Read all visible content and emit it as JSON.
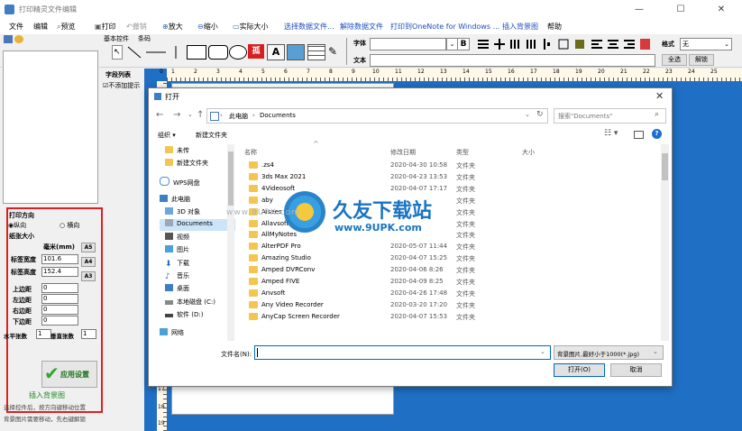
{
  "app": {
    "title": "打印精灵文件编辑",
    "win_controls": {
      "minimize": "—",
      "maximize": "☐",
      "close": "✕"
    }
  },
  "menu": [
    {
      "label": "文件"
    },
    {
      "label": "编辑"
    },
    {
      "label": "预览"
    },
    {
      "label": "打印"
    },
    {
      "label": "撤销"
    },
    {
      "label": "放大"
    },
    {
      "label": "缩小"
    },
    {
      "label": "实际大小"
    },
    {
      "label": "选择数据文件..."
    },
    {
      "label": "解除数据文件"
    },
    {
      "label": "打印到OneNote for Windows ..."
    },
    {
      "label": "插入背景图"
    },
    {
      "label": "帮助"
    }
  ],
  "toolbar": {
    "tabs": [
      "基本控件",
      "条码"
    ],
    "font_label": "字体",
    "text_label": "文本",
    "bold": "B",
    "style_label": "格式",
    "style_value": "无",
    "select_all": "全选",
    "unlock": "解锁",
    "arc_char": "孤",
    "a_char": "A"
  },
  "left_panel": {
    "field_list_label": "字段列表",
    "no_add_checkbox": "不添加提示",
    "print_direction_label": "打印方向",
    "portrait": "纵向",
    "landscape": "横向",
    "paper_size_label": "纸张大小",
    "unit_label": "毫米(mm)",
    "size_buttons": [
      "A5",
      "A4",
      "A3"
    ],
    "label_width_label": "标签宽度",
    "label_width": "101.6",
    "label_height_label": "标签高度",
    "label_height": "152.4",
    "margin_top_label": "上边距",
    "margin_top": "0",
    "margin_left_label": "左边距",
    "margin_left": "0",
    "margin_right_label": "右边距",
    "margin_right": "0",
    "margin_bottom_label": "下边距",
    "margin_bottom": "0",
    "h_count_label": "水平张数",
    "h_count": "1",
    "v_count_label": "垂直张数",
    "v_count": "1",
    "apply_button": "应用设置",
    "insert_bg": "插入背景图",
    "hint1": "选择控件后，按方向键移动位置",
    "hint2": "背景图片需要移动，先右键解锁"
  },
  "ruler": {
    "numbers": [
      "1",
      "2",
      "3",
      "4",
      "5",
      "6",
      "7",
      "8",
      "9",
      "10",
      "11",
      "12",
      "13",
      "14",
      "15",
      "16",
      "17",
      "18",
      "19",
      "20",
      "21",
      "22",
      "23",
      "24",
      "25"
    ],
    "vertical_numbers": [
      "17",
      "18",
      "19"
    ]
  },
  "dialog": {
    "title": "打开",
    "path": [
      "此电脑",
      "Documents"
    ],
    "search_placeholder": "搜索\"Documents\"",
    "organize": "组织 ▾",
    "new_folder": "新建文件夹",
    "columns": {
      "name": "名称",
      "date": "修改日期",
      "type": "类型",
      "size": "大小"
    },
    "nav": [
      {
        "label": "未传",
        "icon": "folder-icon"
      },
      {
        "label": "新建文件夹",
        "icon": "folder-icon"
      },
      {
        "label": "WPS网盘",
        "icon": "cloud-icon"
      },
      {
        "label": "此电脑",
        "icon": "computer-icon"
      },
      {
        "label": "3D 对象",
        "icon": "cube-icon"
      },
      {
        "label": "Documents",
        "icon": "document-icon",
        "selected": true
      },
      {
        "label": "视频",
        "icon": "video-icon"
      },
      {
        "label": "图片",
        "icon": "picture-icon"
      },
      {
        "label": "下载",
        "icon": "download-icon"
      },
      {
        "label": "音乐",
        "icon": "music-icon"
      },
      {
        "label": "桌面",
        "icon": "desktop-icon"
      },
      {
        "label": "本地磁盘 (C:)",
        "icon": "drive-icon"
      },
      {
        "label": "软件 (D:)",
        "icon": "drive-icon"
      },
      {
        "label": "网络",
        "icon": "network-icon"
      }
    ],
    "files": [
      {
        "name": ".zs4",
        "date": "2020-04-30 10:58",
        "type": "文件夹"
      },
      {
        "name": "3ds Max 2021",
        "date": "2020-04-23 13:53",
        "type": "文件夹"
      },
      {
        "name": "4Videosoft",
        "date": "2020-04-07 17:17",
        "type": "文件夹"
      },
      {
        "name": "aby",
        "date": "",
        "type": "文件夹"
      },
      {
        "name": "Aisees",
        "date": "",
        "type": "文件夹"
      },
      {
        "name": "Allavsoft",
        "date": "",
        "type": "文件夹"
      },
      {
        "name": "AllMyNotes",
        "date": "",
        "type": "文件夹"
      },
      {
        "name": "AlterPDF Pro",
        "date": "2020-05-07 11:44",
        "type": "文件夹"
      },
      {
        "name": "Amazing Studio",
        "date": "2020-04-07 15:25",
        "type": "文件夹"
      },
      {
        "name": "Amped DVRConv",
        "date": "2020-04-06 8:26",
        "type": "文件夹"
      },
      {
        "name": "Amped FIVE",
        "date": "2020-04-09 8:25",
        "type": "文件夹"
      },
      {
        "name": "Anvsoft",
        "date": "2020-04-26 17:48",
        "type": "文件夹"
      },
      {
        "name": "Any Video Recorder",
        "date": "2020-03-20 17:20",
        "type": "文件夹"
      },
      {
        "name": "AnyCap Screen Recorder",
        "date": "2020-04-07 15:53",
        "type": "文件夹"
      }
    ],
    "filename_label": "文件名(N):",
    "filename_value": "",
    "filter": "背景图片,最好小于1000(*.jpg)",
    "open_button": "打开(O)",
    "cancel_button": "取消"
  },
  "watermark": {
    "text": "久友下载站",
    "url": "www.9UPK.com",
    "faint": "www.9UPK.com"
  },
  "colors": {
    "canvas_blue": "#1f6fc4",
    "red_outline": "#e02020",
    "green_text": "#1a8a1a",
    "accent": "#0067c0"
  }
}
